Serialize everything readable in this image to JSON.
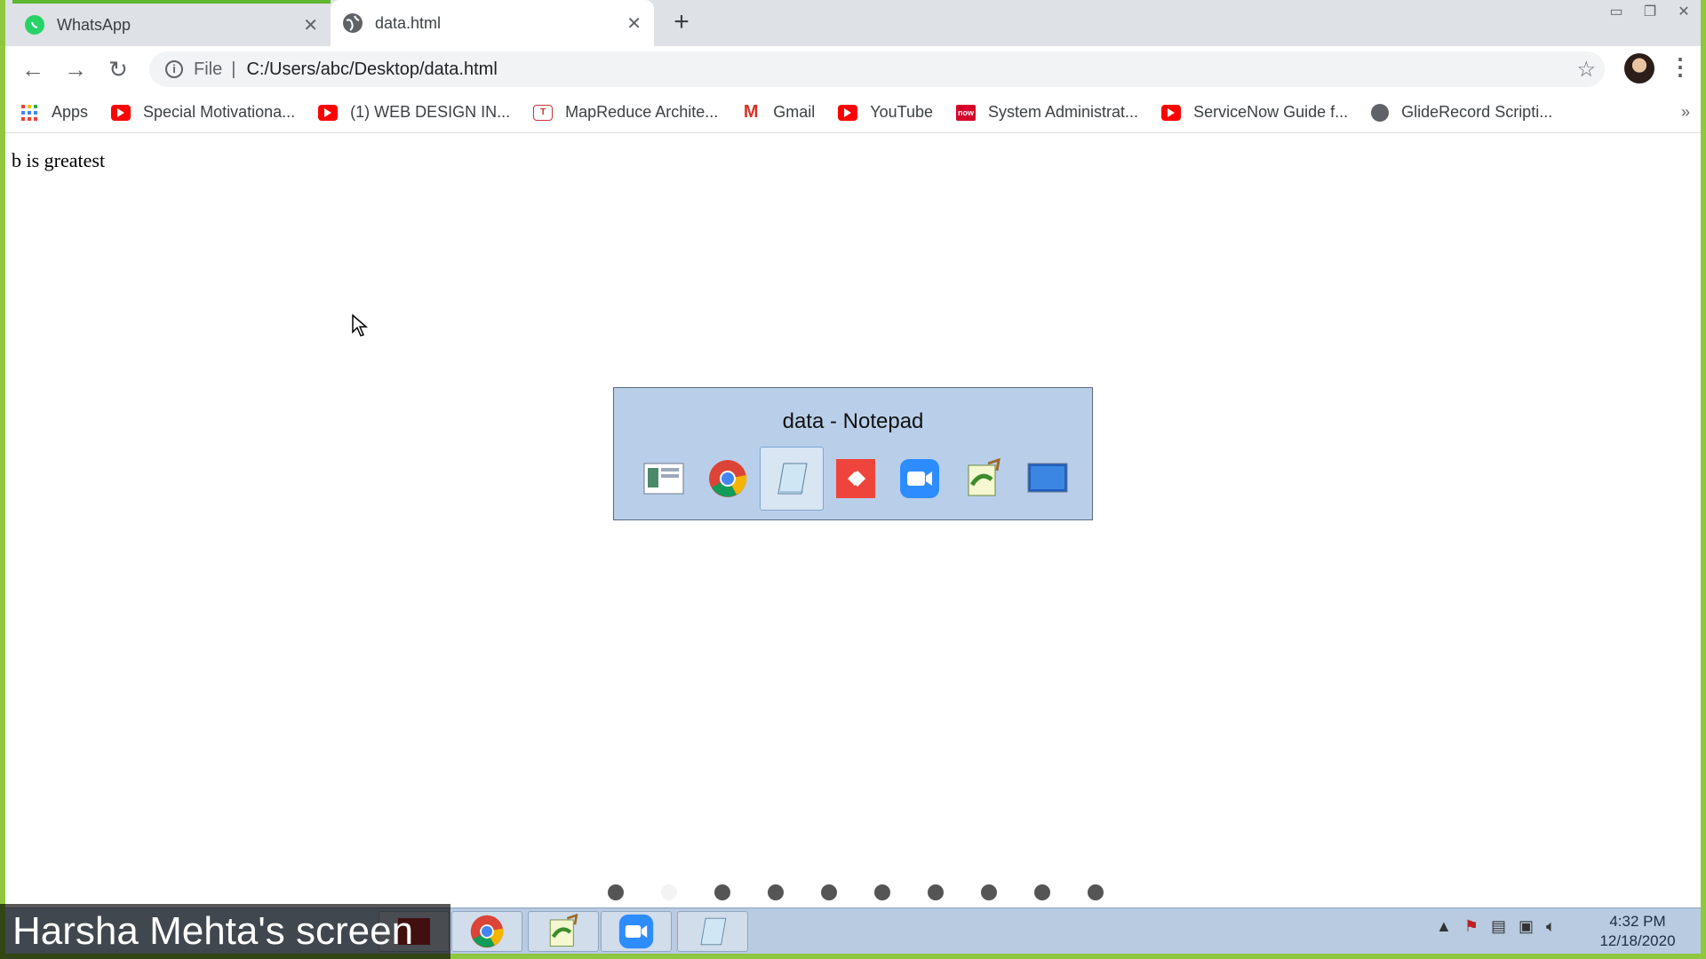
{
  "tabs": [
    {
      "title": "WhatsApp"
    },
    {
      "title": "data.html"
    }
  ],
  "toolbar": {
    "scheme": "File",
    "url": "C:/Users/abc/Desktop/data.html"
  },
  "bookmarks": [
    {
      "label": "Apps",
      "icon": "apps-grid-icon"
    },
    {
      "label": "Special Motivationa...",
      "icon": "youtube-icon"
    },
    {
      "label": "(1) WEB DESIGN IN...",
      "icon": "youtube-icon"
    },
    {
      "label": "MapReduce Archite...",
      "icon": "site-icon"
    },
    {
      "label": "Gmail",
      "icon": "gmail-icon"
    },
    {
      "label": "YouTube",
      "icon": "youtube-icon"
    },
    {
      "label": "System Administrat...",
      "icon": "servicenow-icon"
    },
    {
      "label": "ServiceNow Guide f...",
      "icon": "youtube-icon"
    },
    {
      "label": "GlideRecord Scripti...",
      "icon": "globe-icon"
    }
  ],
  "page": {
    "text": "b is greatest"
  },
  "switcher": {
    "title": "data - Notepad",
    "apps": [
      "desktop",
      "chrome",
      "notepad",
      "anydesk",
      "zoom",
      "notepad-plus",
      "screen"
    ],
    "selected_index": 2
  },
  "pager": {
    "count": 10,
    "active_index": 1
  },
  "taskbar": {
    "apps": [
      "chrome",
      "notepad-plus",
      "zoom",
      "notepad"
    ]
  },
  "clock": {
    "time": "4:32 PM",
    "date": "12/18/2020"
  },
  "share_label": "Harsha Mehta's screen",
  "colors": {
    "frame": "#8fc73e",
    "tabstrip": "#dee1e6",
    "switcher": "#b9cfe9",
    "taskbar": "#b8cbe0"
  }
}
